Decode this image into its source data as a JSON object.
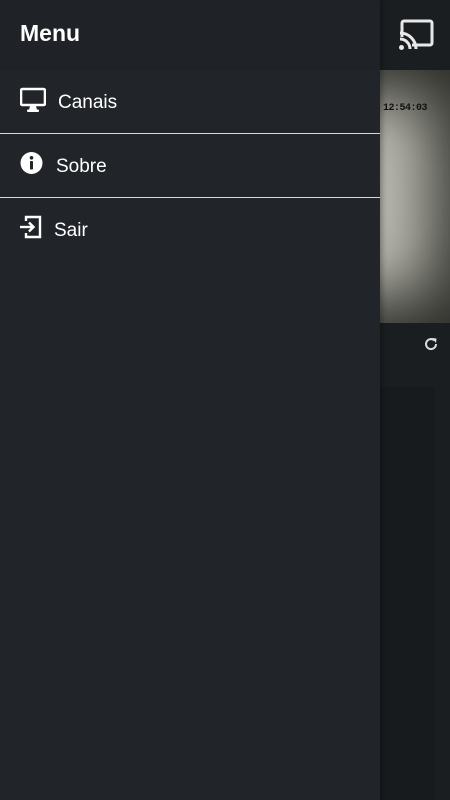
{
  "drawer": {
    "title": "Menu",
    "items": [
      {
        "label": "Canais",
        "icon": "monitor-icon"
      },
      {
        "label": "Sobre",
        "icon": "info-icon"
      },
      {
        "label": "Sair",
        "icon": "logout-icon"
      }
    ]
  },
  "background": {
    "cast_icon": "cast-icon",
    "video_timestamp": "12:54:03",
    "refresh_icon": "refresh-icon"
  },
  "colors": {
    "drawer_bg": "#212529",
    "divider": "#d8d8d8",
    "text": "#ffffff"
  }
}
